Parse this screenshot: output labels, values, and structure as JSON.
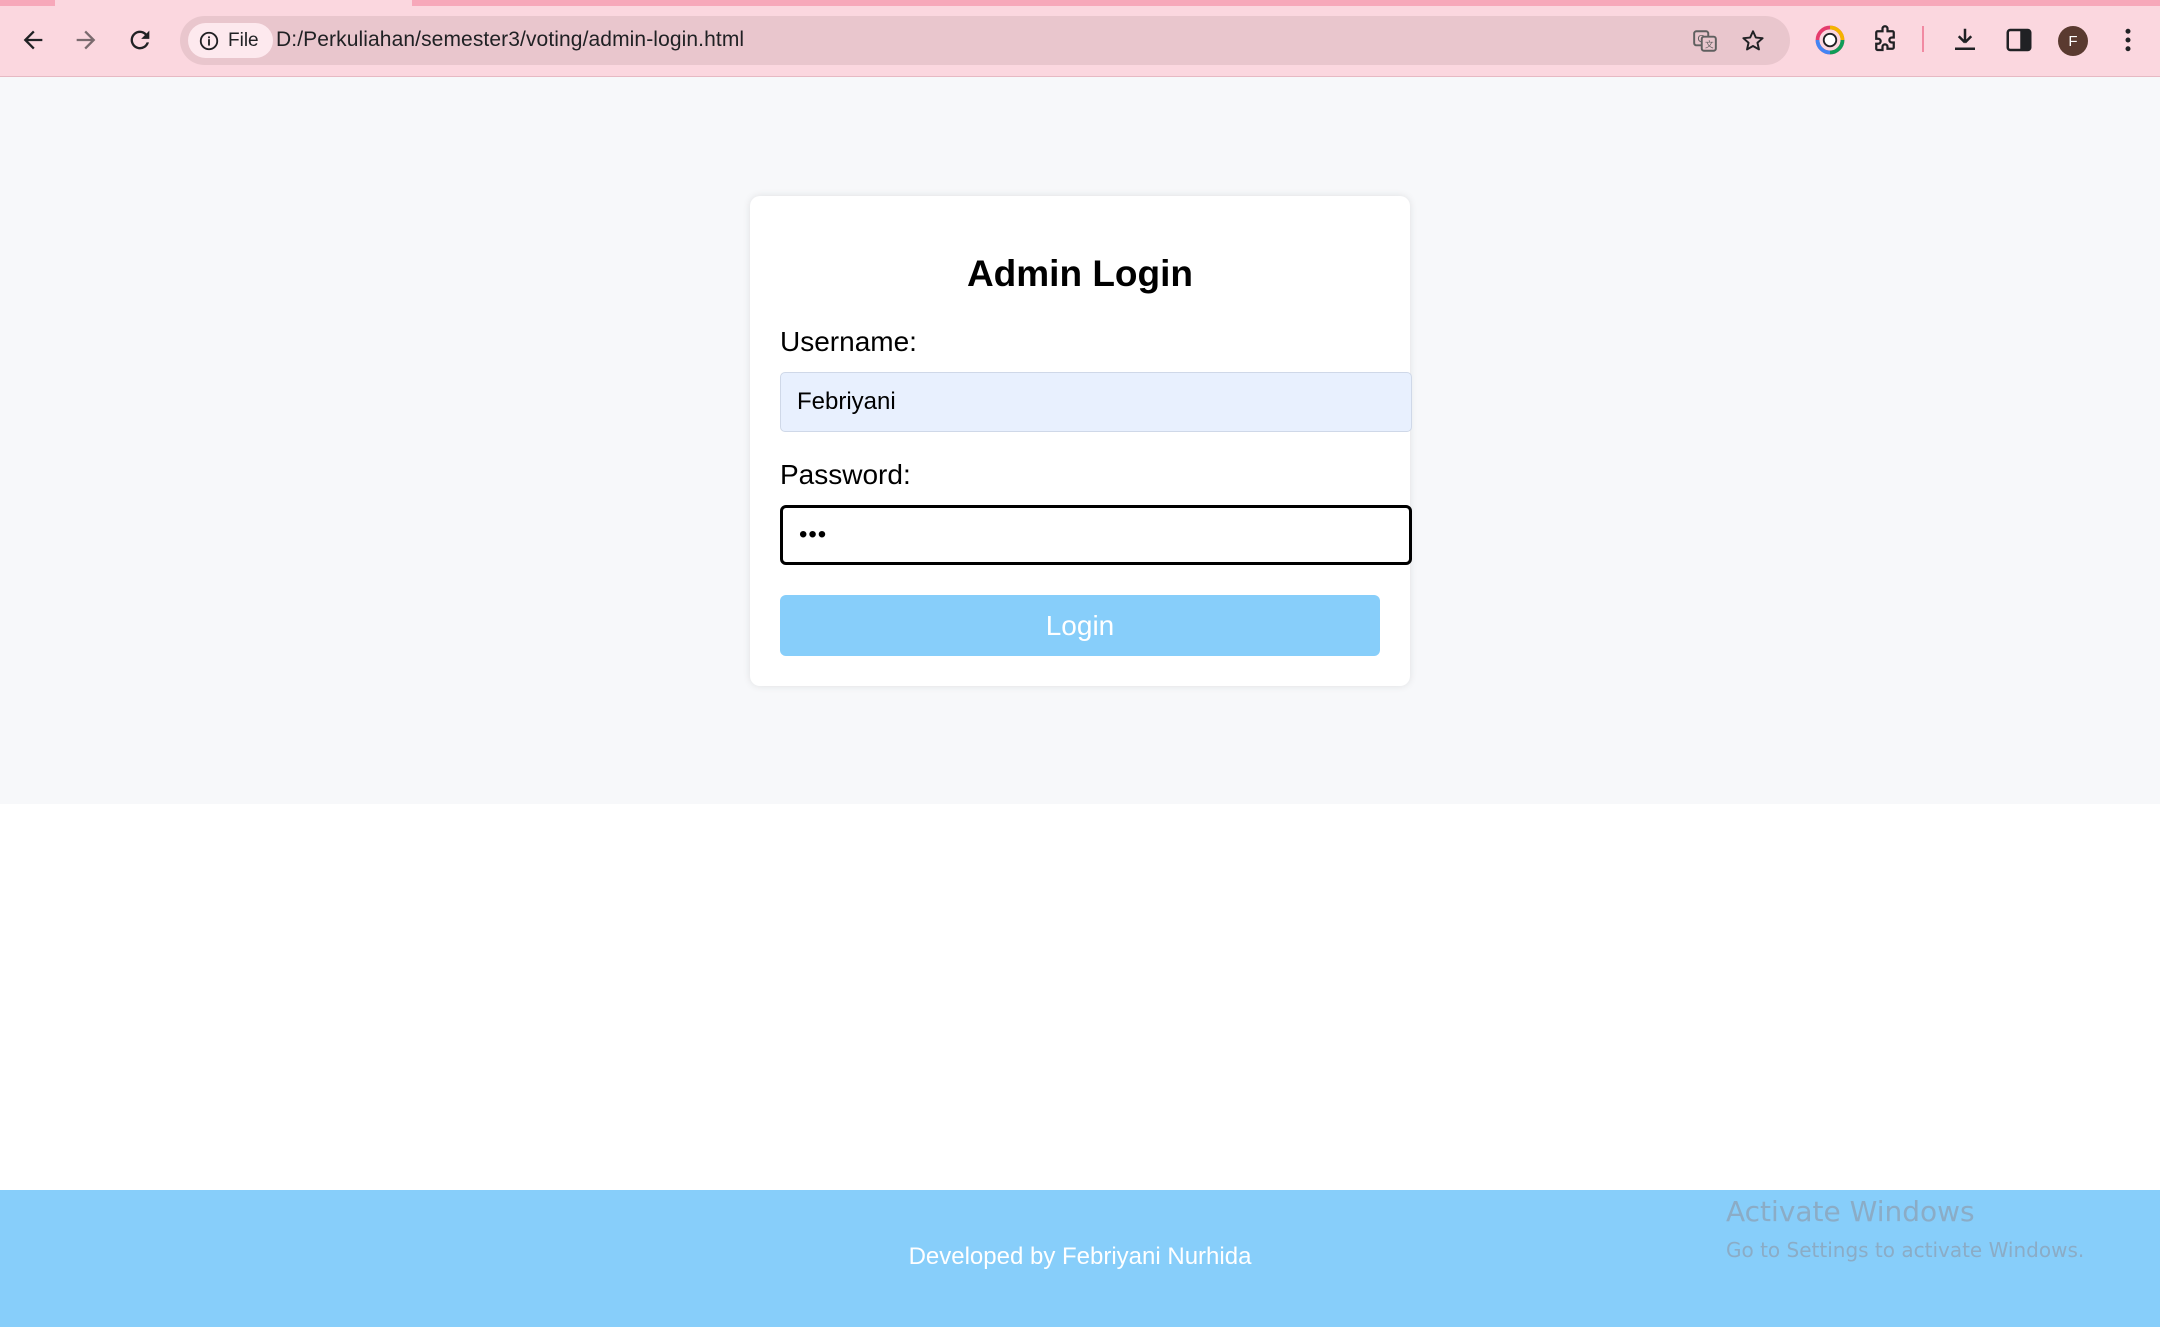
{
  "browser": {
    "chip_label": "File",
    "url": "D:/Perkuliahan/semester3/voting/admin-login.html",
    "profile_initial": "F",
    "icons": [
      "back-arrow-icon",
      "forward-arrow-icon",
      "reload-icon",
      "info-icon",
      "translate-icon",
      "star-icon",
      "color-extension-icon",
      "puzzle-icon",
      "download-icon",
      "side-panel-icon",
      "more-vert-icon"
    ]
  },
  "login": {
    "title": "Admin Login",
    "username_label": "Username:",
    "username_value": "Febriyani",
    "password_label": "Password:",
    "password_value": "•••",
    "button_label": "Login"
  },
  "footer": {
    "credit": "Developed by Febriyani Nurhida"
  },
  "watermark": {
    "line1": "Activate Windows",
    "line2": "Go to Settings to activate Windows."
  },
  "colors": {
    "chrome_bg": "#fbd7df",
    "accent": "#87cefa",
    "page_bg": "#f7f8fa",
    "autofill_bg": "#e8f0fe"
  }
}
